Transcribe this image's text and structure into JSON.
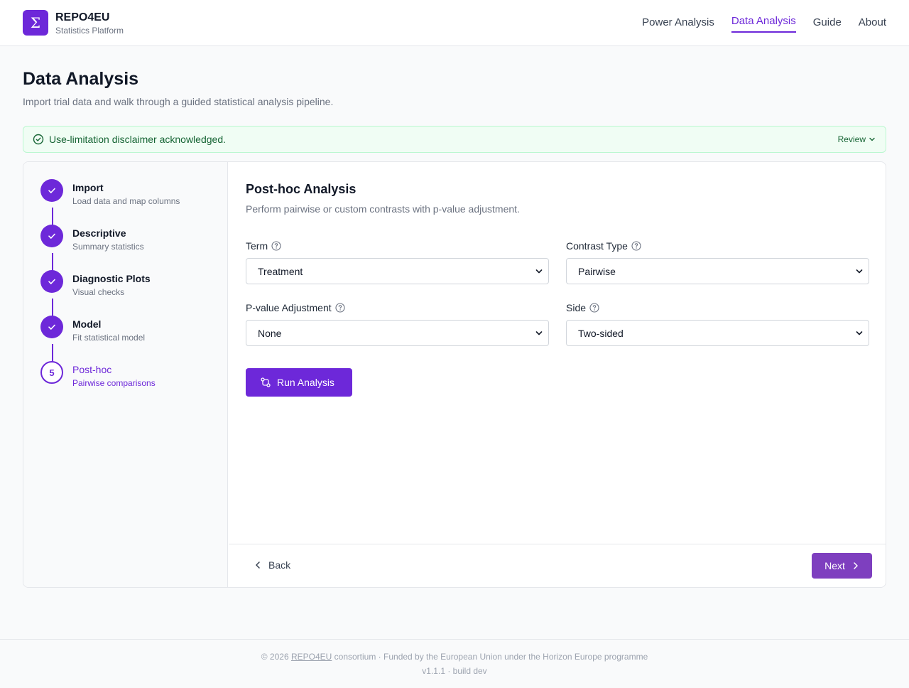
{
  "header": {
    "logo_glyph": "Σ",
    "brand_name": "REPO4EU",
    "brand_sub": "Statistics Platform",
    "nav": [
      {
        "label": "Power Analysis",
        "active": false
      },
      {
        "label": "Data Analysis",
        "active": true
      },
      {
        "label": "Guide",
        "active": false
      },
      {
        "label": "About",
        "active": false
      }
    ]
  },
  "page": {
    "title": "Data Analysis",
    "subtitle": "Import trial data and walk through a guided statistical analysis pipeline."
  },
  "banner": {
    "text": "Use-limitation disclaimer acknowledged.",
    "review_label": "Review",
    "icon": "check-circle-icon"
  },
  "steps": [
    {
      "title": "Import",
      "desc": "Load data and map columns",
      "state": "done"
    },
    {
      "title": "Descriptive",
      "desc": "Summary statistics",
      "state": "done"
    },
    {
      "title": "Diagnostic Plots",
      "desc": "Visual checks",
      "state": "done"
    },
    {
      "title": "Model",
      "desc": "Fit statistical model",
      "state": "done"
    },
    {
      "title": "Post-hoc",
      "desc": "Pairwise comparisons",
      "state": "current",
      "number": "5"
    }
  ],
  "section": {
    "title": "Post-hoc Analysis",
    "subtitle": "Perform pairwise or custom contrasts with p-value adjustment."
  },
  "fields": {
    "term": {
      "label": "Term",
      "value": "Treatment"
    },
    "contrast": {
      "label": "Contrast Type",
      "value": "Pairwise"
    },
    "padjust": {
      "label": "P-value Adjustment",
      "value": "None"
    },
    "side": {
      "label": "Side",
      "value": "Two-sided"
    }
  },
  "actions": {
    "run_label": "Run Analysis",
    "back_label": "Back",
    "next_label": "Next"
  },
  "footer": {
    "prefix": "© 2026 ",
    "link": "REPO4EU",
    "suffix": " consortium · Funded by the European Union under the Horizon Europe programme",
    "version": "v1.1.1 · build dev"
  },
  "colors": {
    "accent": "#6d28d9",
    "success_bg": "#f0fdf4",
    "success_text": "#166534"
  }
}
